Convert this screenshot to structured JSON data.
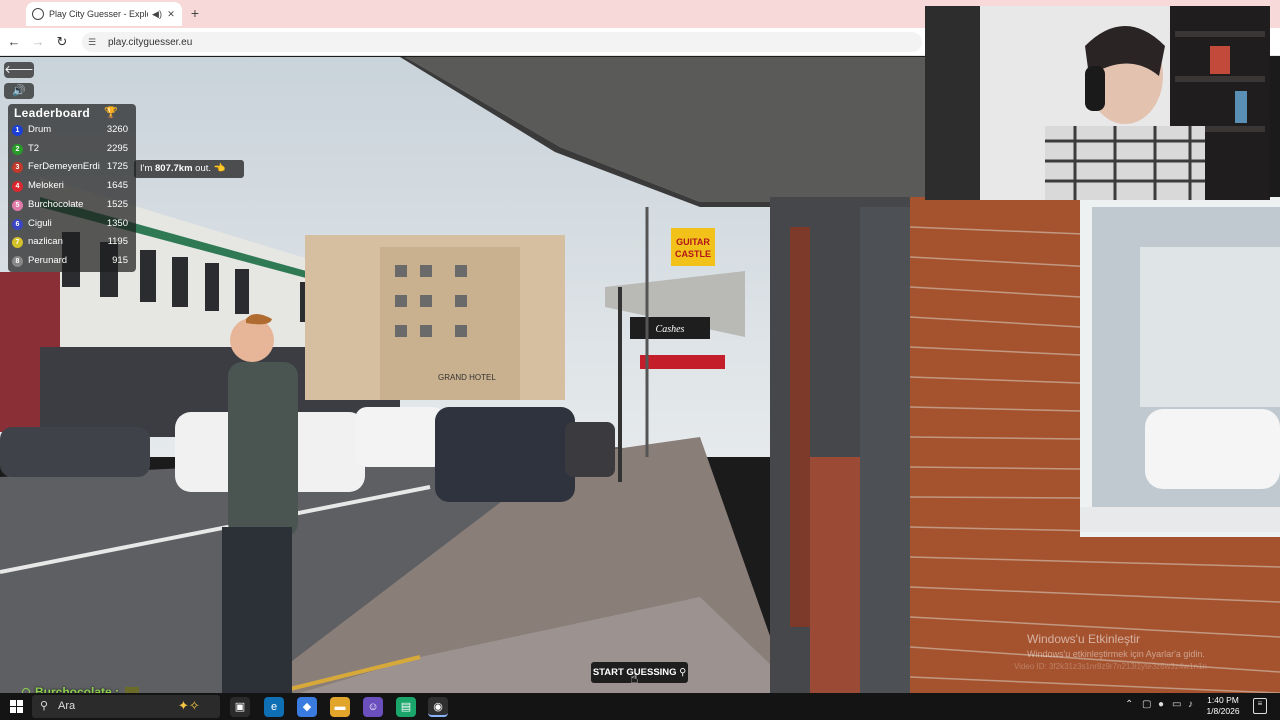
{
  "browser": {
    "tab_title": "Play City Guesser - Explore",
    "tab_audio_icon": "speaker-icon",
    "tab_close": "✕",
    "new_tab": "+",
    "url": "play.cityguesser.eu"
  },
  "game": {
    "back_label": "🡐",
    "sound_label": "🔊",
    "leaderboard": {
      "title": "Leaderboard",
      "trophy": "🏆",
      "rows": [
        {
          "rank": "1",
          "name": "Drum",
          "score": "3260",
          "color": "#1c3fd6"
        },
        {
          "rank": "2",
          "name": "T2",
          "score": "2295",
          "color": "#2a9b2a"
        },
        {
          "rank": "3",
          "name": "FerDemeyenErdi",
          "score": "1725",
          "color": "#c0392b"
        },
        {
          "rank": "4",
          "name": "Melokeri",
          "score": "1645",
          "color": "#d9282f"
        },
        {
          "rank": "5",
          "name": "Burchocolate",
          "score": "1525",
          "color": "#e07aa9"
        },
        {
          "rank": "6",
          "name": "Ciguli",
          "score": "1350",
          "color": "#3b46c4"
        },
        {
          "rank": "7",
          "name": "nazlican",
          "score": "1195",
          "color": "#d4c12a"
        },
        {
          "rank": "8",
          "name": "Perunard",
          "score": "915",
          "color": "#888888"
        }
      ]
    },
    "bubble": {
      "prefix": "I'm ",
      "distance": "807.7km",
      "suffix": " out.",
      "emoji": "👈"
    },
    "start_guessing": "START GUESSING",
    "street_signs": {
      "guitar_castle_1": "GUITAR",
      "guitar_castle_2": "CASTLE",
      "cashes": "Cashes",
      "hotel": "GRAND HOTEL"
    }
  },
  "chat": {
    "user": "Burchocolate",
    "sep": " :"
  },
  "watermark": {
    "line1": "Windows'u Etkinleştir",
    "line2": "Windows'u etkinleştirmek için Ayarlar'a gidin.",
    "line3": "Video ID: 3f2k31z3s1nr8z9r7n213l1yte3z6w3z4w1n1n"
  },
  "taskbar": {
    "search_placeholder": "Ara",
    "time": "1:40 PM",
    "date": "1/8/2026"
  }
}
